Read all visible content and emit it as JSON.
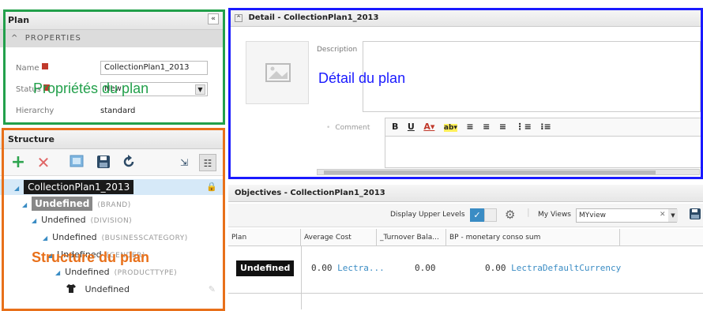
{
  "plan": {
    "title": "Plan",
    "collapse_icon": "«",
    "properties_heading": "PROPERTIES",
    "name_label": "Name",
    "name_value": "CollectionPlan1_2013",
    "status_label": "Status",
    "status_value": "New",
    "hierarchy_label": "Hierarchy",
    "hierarchy_value": "standard"
  },
  "structure": {
    "title": "Structure",
    "tree": [
      {
        "label": "CollectionPlan1_2013",
        "sub": ""
      },
      {
        "label": "Undefined",
        "sub": "(BRAND)"
      },
      {
        "label": "Undefined",
        "sub": "(DIVISION)"
      },
      {
        "label": "Undefined",
        "sub": "(BUSINESSCATEGORY)"
      },
      {
        "label": "Undefined",
        "sub": "(GENDER)"
      },
      {
        "label": "Undefined",
        "sub": "(PRODUCTTYPE)"
      },
      {
        "label": "Undefined",
        "sub": ""
      }
    ]
  },
  "detail": {
    "title": "Detail - CollectionPlan1_2013",
    "description_label": "Description",
    "comment_label": "Comment"
  },
  "objectives": {
    "title": "Objectives - CollectionPlan1_2013",
    "display_upper_levels": "Display Upper Levels",
    "my_views_label": "My Views",
    "my_views_value": "MYview",
    "columns": [
      "Plan",
      "Average Cost",
      "_Turnover Bala...",
      "BP - monetary conso sum"
    ],
    "row": {
      "plan": "Undefined",
      "avg_value": "0.00",
      "avg_currency": "Lectra...",
      "turnover": "0.00",
      "bp_value": "0.00",
      "bp_currency": "LectraDefaultCurrency"
    }
  },
  "annotations": {
    "plan_properties": "Propriétés du plan",
    "plan_detail": "Détail du plan",
    "plan_structure": "Structure du plan",
    "colors": {
      "green": "#22a04b",
      "blue": "#1a1aff",
      "orange": "#e8701a"
    }
  }
}
